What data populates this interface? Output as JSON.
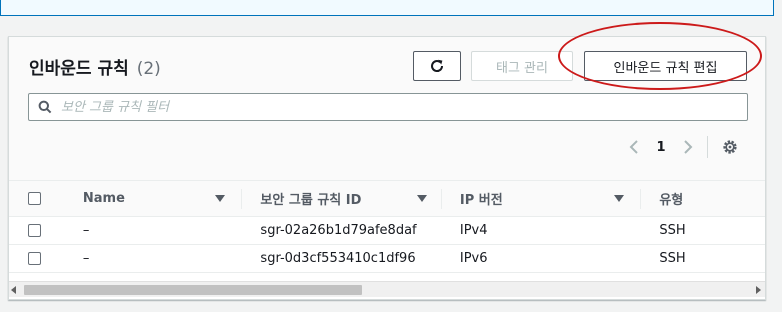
{
  "panel": {
    "title": "인바운드 규칙",
    "count": "(2)"
  },
  "toolbar": {
    "refresh_icon": "refresh-icon",
    "tags_label": "태그 관리",
    "edit_label": "인바운드 규칙 편집"
  },
  "search": {
    "placeholder": "보안 그룹 규칙 필터"
  },
  "pagination": {
    "current_page": "1"
  },
  "table": {
    "columns": [
      "Name",
      "보안 그룹 규칙 ID",
      "IP 버전",
      "유형"
    ],
    "rows": [
      {
        "name": "–",
        "rule_id": "sgr-02a26b1d79afe8daf",
        "ip_version": "IPv4",
        "type": "SSH"
      },
      {
        "name": "–",
        "rule_id": "sgr-0d3cf553410c1df96",
        "ip_version": "IPv6",
        "type": "SSH"
      }
    ]
  },
  "colors": {
    "annotation_oval": "#cc1a1a",
    "info_border": "#0073bb",
    "button_border": "#545b64",
    "disabled_text": "#aab7b8"
  }
}
